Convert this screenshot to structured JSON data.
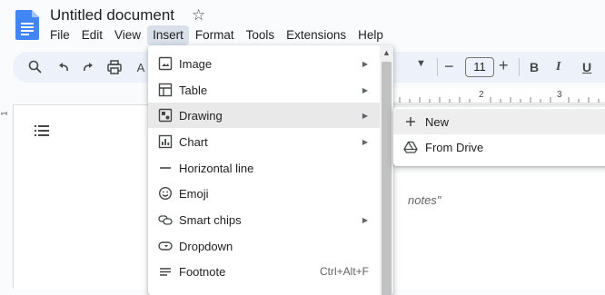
{
  "document": {
    "title": "Untitled document"
  },
  "menubar": {
    "items": [
      {
        "label": "File"
      },
      {
        "label": "Edit"
      },
      {
        "label": "View"
      },
      {
        "label": "Insert"
      },
      {
        "label": "Format"
      },
      {
        "label": "Tools"
      },
      {
        "label": "Extensions"
      },
      {
        "label": "Help"
      }
    ],
    "active": "Insert"
  },
  "toolbar": {
    "font_size": "11",
    "minus_label": "−",
    "plus_label": "+",
    "bold_label": "B",
    "italic_label": "I",
    "underline_label": "U"
  },
  "ruler": {
    "marks": [
      "2",
      "3"
    ],
    "vertical_mark": "1"
  },
  "page": {
    "visible_text": "notes\""
  },
  "insert_menu": {
    "items": [
      {
        "label": "Image",
        "icon": "image-icon",
        "submenu": true
      },
      {
        "label": "Table",
        "icon": "table-icon",
        "submenu": true
      },
      {
        "label": "Drawing",
        "icon": "drawing-icon",
        "submenu": true,
        "highlighted": true
      },
      {
        "label": "Chart",
        "icon": "chart-icon",
        "submenu": true
      },
      {
        "label": "Horizontal line",
        "icon": "horizontal-line-icon",
        "submenu": false
      },
      {
        "label": "Emoji",
        "icon": "emoji-icon",
        "submenu": false
      },
      {
        "label": "Smart chips",
        "icon": "smart-chips-icon",
        "submenu": true
      },
      {
        "label": "Dropdown",
        "icon": "dropdown-icon",
        "submenu": false
      },
      {
        "label": "Footnote",
        "icon": "footnote-icon",
        "submenu": false,
        "shortcut": "Ctrl+Alt+F"
      }
    ]
  },
  "drawing_submenu": {
    "items": [
      {
        "label": "New",
        "icon": "plus-icon"
      },
      {
        "label": "From Drive",
        "icon": "drive-icon"
      }
    ]
  },
  "colors": {
    "docs_blue": "#4285f4",
    "active_menu_bg": "#d9e0ea",
    "toolbar_bg": "#edf2fa"
  }
}
